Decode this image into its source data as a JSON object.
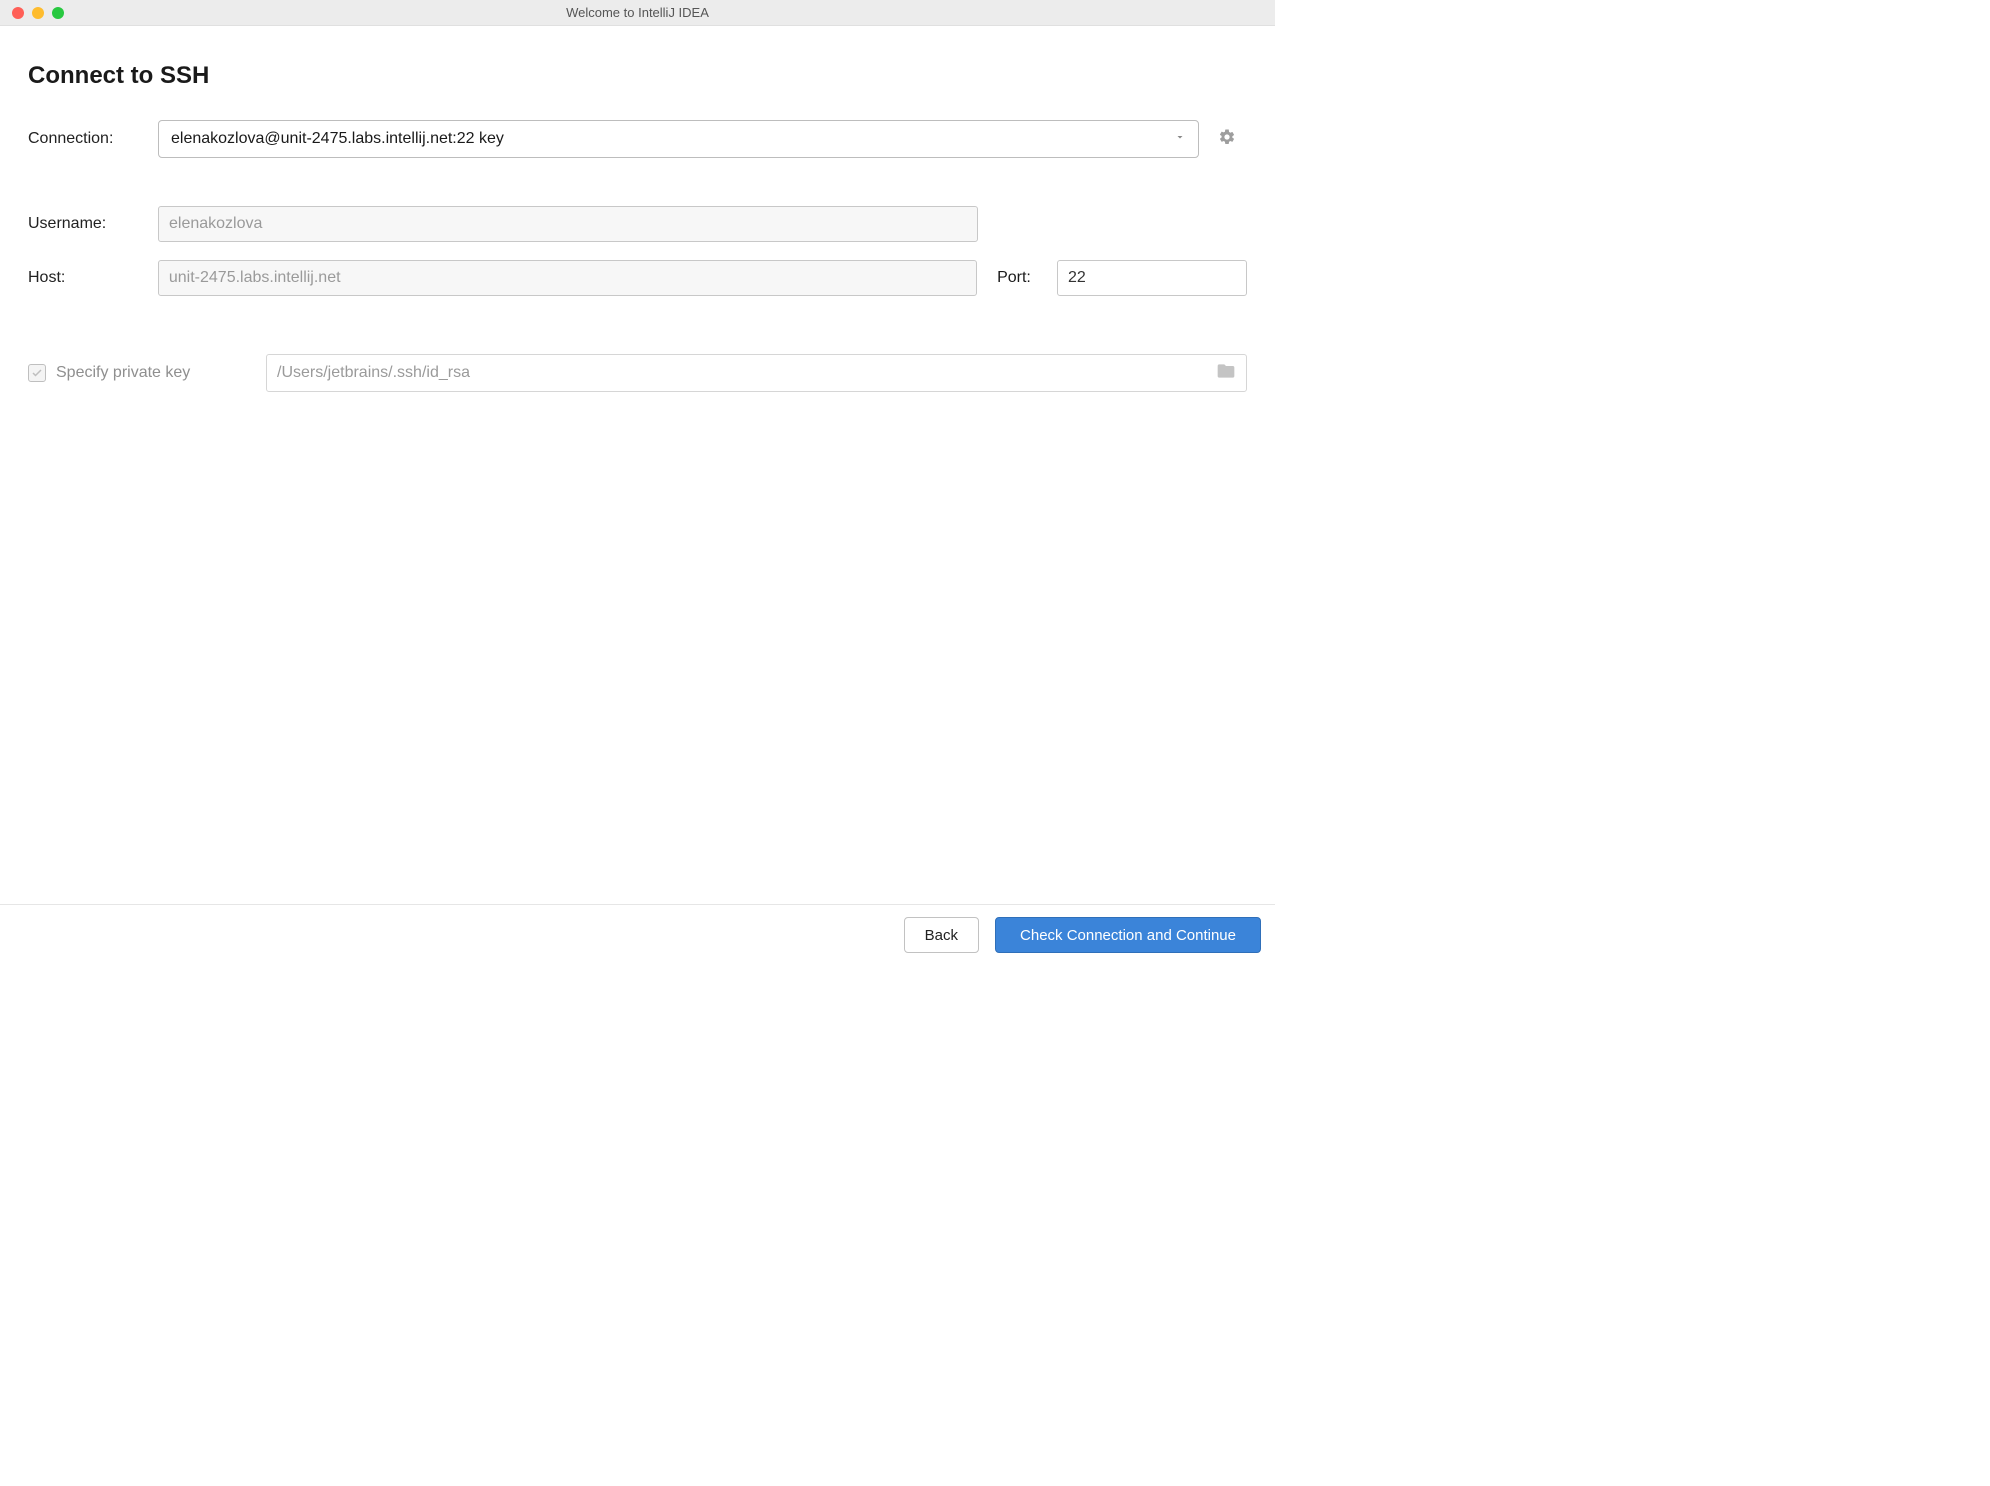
{
  "window": {
    "title": "Welcome to IntelliJ IDEA"
  },
  "page": {
    "title": "Connect to SSH"
  },
  "connection": {
    "label": "Connection:",
    "selected": "elenakozlova@unit-2475.labs.intellij.net:22 key"
  },
  "fields": {
    "username_label": "Username:",
    "username_value": "elenakozlova",
    "host_label": "Host:",
    "host_value": "unit-2475.labs.intellij.net",
    "port_label": "Port:",
    "port_value": "22"
  },
  "private_key": {
    "checkbox_label": "Specify private key",
    "path": "/Users/jetbrains/.ssh/id_rsa"
  },
  "footer": {
    "back": "Back",
    "continue": "Check Connection and Continue"
  }
}
